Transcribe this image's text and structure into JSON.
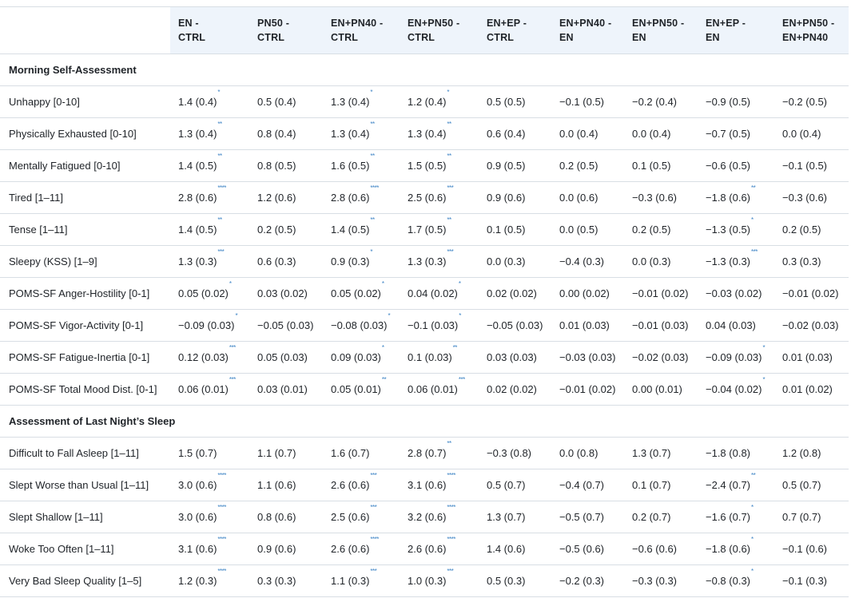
{
  "table": {
    "headers": [
      "",
      "EN - CTRL",
      "PN50 - CTRL",
      "EN+PN40 - CTRL",
      "EN+PN50 - CTRL",
      "EN+EP - CTRL",
      "EN+PN40 - EN",
      "EN+PN50 - EN",
      "EN+EP - EN",
      "EN+PN50 - EN+PN40"
    ],
    "header_lines": [
      [
        "",
        ""
      ],
      [
        "EN -",
        "CTRL"
      ],
      [
        "PN50 -",
        "CTRL"
      ],
      [
        "EN+PN40 -",
        "CTRL"
      ],
      [
        "EN+PN50 -",
        "CTRL"
      ],
      [
        "EN+EP -",
        "CTRL"
      ],
      [
        "EN+PN40 -",
        "EN"
      ],
      [
        "EN+PN50 -",
        "EN"
      ],
      [
        "EN+EP -",
        "EN"
      ],
      [
        "EN+PN50 -",
        "EN+PN40"
      ]
    ],
    "sections": [
      {
        "title": "Morning Self-Assessment",
        "rows": [
          {
            "label": "Unhappy [0-10]",
            "cells": [
              [
                "1.4 (0.4)",
                "*"
              ],
              [
                "0.5 (0.4)",
                ""
              ],
              [
                "1.3 (0.4)",
                "*"
              ],
              [
                "1.2 (0.4)",
                "*"
              ],
              [
                "0.5 (0.5)",
                ""
              ],
              [
                "−0.1 (0.5)",
                ""
              ],
              [
                "−0.2 (0.4)",
                ""
              ],
              [
                "−0.9 (0.5)",
                ""
              ],
              [
                "−0.2 (0.5)",
                ""
              ]
            ]
          },
          {
            "label": "Physically Exhausted [0-10]",
            "cells": [
              [
                "1.3 (0.4)",
                "**"
              ],
              [
                "0.8 (0.4)",
                ""
              ],
              [
                "1.3 (0.4)",
                "**"
              ],
              [
                "1.3 (0.4)",
                "**"
              ],
              [
                "0.6 (0.4)",
                ""
              ],
              [
                "0.0 (0.4)",
                ""
              ],
              [
                "0.0 (0.4)",
                ""
              ],
              [
                "−0.7 (0.5)",
                ""
              ],
              [
                "0.0 (0.4)",
                ""
              ]
            ]
          },
          {
            "label": "Mentally Fatigued [0-10]",
            "cells": [
              [
                "1.4 (0.5)",
                "**"
              ],
              [
                "0.8 (0.5)",
                ""
              ],
              [
                "1.6 (0.5)",
                "**"
              ],
              [
                "1.5 (0.5)",
                "**"
              ],
              [
                "0.9 (0.5)",
                ""
              ],
              [
                "0.2 (0.5)",
                ""
              ],
              [
                "0.1 (0.5)",
                ""
              ],
              [
                "−0.6 (0.5)",
                ""
              ],
              [
                "−0.1 (0.5)",
                ""
              ]
            ]
          },
          {
            "label": "Tired [1–11]",
            "cells": [
              [
                "2.8 (0.6)",
                "****"
              ],
              [
                "1.2 (0.6)",
                ""
              ],
              [
                "2.8 (0.6)",
                "****"
              ],
              [
                "2.5 (0.6)",
                "***"
              ],
              [
                "0.9 (0.6)",
                ""
              ],
              [
                "0.0 (0.6)",
                ""
              ],
              [
                "−0.3 (0.6)",
                ""
              ],
              [
                "−1.8 (0.6)",
                "**"
              ],
              [
                "−0.3 (0.6)",
                ""
              ]
            ]
          },
          {
            "label": "Tense [1–11]",
            "cells": [
              [
                "1.4 (0.5)",
                "**"
              ],
              [
                "0.2 (0.5)",
                ""
              ],
              [
                "1.4 (0.5)",
                "**"
              ],
              [
                "1.7 (0.5)",
                "**"
              ],
              [
                "0.1 (0.5)",
                ""
              ],
              [
                "0.0 (0.5)",
                ""
              ],
              [
                "0.2 (0.5)",
                ""
              ],
              [
                "−1.3 (0.5)",
                "*"
              ],
              [
                "0.2 (0.5)",
                ""
              ]
            ]
          },
          {
            "label": "Sleepy (KSS) [1–9]",
            "cells": [
              [
                "1.3 (0.3)",
                "***"
              ],
              [
                "0.6 (0.3)",
                ""
              ],
              [
                "0.9 (0.3)",
                "*"
              ],
              [
                "1.3 (0.3)",
                "***"
              ],
              [
                "0.0 (0.3)",
                ""
              ],
              [
                "−0.4 (0.3)",
                ""
              ],
              [
                "0.0 (0.3)",
                ""
              ],
              [
                "−1.3 (0.3)",
                "***"
              ],
              [
                "0.3 (0.3)",
                ""
              ]
            ]
          },
          {
            "label": "POMS-SF Anger-Hostility [0-1]",
            "cells": [
              [
                "0.05 (0.02)",
                "*"
              ],
              [
                "0.03 (0.02)",
                ""
              ],
              [
                "0.05 (0.02)",
                "*"
              ],
              [
                "0.04 (0.02)",
                "*"
              ],
              [
                "0.02 (0.02)",
                ""
              ],
              [
                "0.00 (0.02)",
                ""
              ],
              [
                "−0.01 (0.02)",
                ""
              ],
              [
                "−0.03 (0.02)",
                ""
              ],
              [
                "−0.01 (0.02)",
                ""
              ]
            ]
          },
          {
            "label": "POMS-SF Vigor-Activity [0-1]",
            "cells": [
              [
                "−0.09 (0.03)",
                "*"
              ],
              [
                "−0.05 (0.03)",
                ""
              ],
              [
                "−0.08 (0.03)",
                "*"
              ],
              [
                "−0.1 (0.03)",
                "*"
              ],
              [
                "−0.05 (0.03)",
                ""
              ],
              [
                "0.01 (0.03)",
                ""
              ],
              [
                "−0.01 (0.03)",
                ""
              ],
              [
                "0.04 (0.03)",
                ""
              ],
              [
                "−0.02 (0.03)",
                ""
              ]
            ]
          },
          {
            "label": "POMS-SF Fatigue-Inertia [0-1]",
            "cells": [
              [
                "0.12 (0.03)",
                "***"
              ],
              [
                "0.05 (0.03)",
                ""
              ],
              [
                "0.09 (0.03)",
                "*"
              ],
              [
                "0.1 (0.03)",
                "**"
              ],
              [
                "0.03 (0.03)",
                ""
              ],
              [
                "−0.03 (0.03)",
                ""
              ],
              [
                "−0.02 (0.03)",
                ""
              ],
              [
                "−0.09 (0.03)",
                "*"
              ],
              [
                "0.01 (0.03)",
                ""
              ]
            ]
          },
          {
            "label": "POMS-SF Total Mood Dist. [0-1]",
            "cells": [
              [
                "0.06 (0.01)",
                "***"
              ],
              [
                "0.03 (0.01)",
                ""
              ],
              [
                "0.05 (0.01)",
                "**"
              ],
              [
                "0.06 (0.01)",
                "***"
              ],
              [
                "0.02 (0.02)",
                ""
              ],
              [
                "−0.01 (0.02)",
                ""
              ],
              [
                "0.00 (0.01)",
                ""
              ],
              [
                "−0.04 (0.02)",
                "*"
              ],
              [
                "0.01 (0.02)",
                ""
              ]
            ]
          }
        ]
      },
      {
        "title": "Assessment of Last Night’s Sleep",
        "rows": [
          {
            "label": "Difficult to Fall Asleep [1–11]",
            "cells": [
              [
                "1.5 (0.7)",
                ""
              ],
              [
                "1.1 (0.7)",
                ""
              ],
              [
                "1.6 (0.7)",
                ""
              ],
              [
                "2.8 (0.7)",
                "**"
              ],
              [
                "−0.3 (0.8)",
                ""
              ],
              [
                "0.0 (0.8)",
                ""
              ],
              [
                "1.3 (0.7)",
                ""
              ],
              [
                "−1.8 (0.8)",
                ""
              ],
              [
                "1.2 (0.8)",
                ""
              ]
            ]
          },
          {
            "label": "Slept Worse than Usual [1–11]",
            "cells": [
              [
                "3.0 (0.6)",
                "****"
              ],
              [
                "1.1 (0.6)",
                ""
              ],
              [
                "2.6 (0.6)",
                "***"
              ],
              [
                "3.1 (0.6)",
                "****"
              ],
              [
                "0.5 (0.7)",
                ""
              ],
              [
                "−0.4 (0.7)",
                ""
              ],
              [
                "0.1 (0.7)",
                ""
              ],
              [
                "−2.4 (0.7)",
                "**"
              ],
              [
                "0.5 (0.7)",
                ""
              ]
            ]
          },
          {
            "label": "Slept Shallow [1–11]",
            "cells": [
              [
                "3.0 (0.6)",
                "****"
              ],
              [
                "0.8 (0.6)",
                ""
              ],
              [
                "2.5 (0.6)",
                "***"
              ],
              [
                "3.2 (0.6)",
                "****"
              ],
              [
                "1.3 (0.7)",
                ""
              ],
              [
                "−0.5 (0.7)",
                ""
              ],
              [
                "0.2 (0.7)",
                ""
              ],
              [
                "−1.6 (0.7)",
                "*"
              ],
              [
                "0.7 (0.7)",
                ""
              ]
            ]
          },
          {
            "label": "Woke Too Often [1–11]",
            "cells": [
              [
                "3.1 (0.6)",
                "****"
              ],
              [
                "0.9 (0.6)",
                ""
              ],
              [
                "2.6 (0.6)",
                "****"
              ],
              [
                "2.6 (0.6)",
                "****"
              ],
              [
                "1.4 (0.6)",
                ""
              ],
              [
                "−0.5 (0.6)",
                ""
              ],
              [
                "−0.6 (0.6)",
                ""
              ],
              [
                "−1.8 (0.6)",
                "*"
              ],
              [
                "−0.1 (0.6)",
                ""
              ]
            ]
          },
          {
            "label": "Very Bad Sleep Quality [1–5]",
            "cells": [
              [
                "1.2 (0.3)",
                "****"
              ],
              [
                "0.3 (0.3)",
                ""
              ],
              [
                "1.1 (0.3)",
                "***"
              ],
              [
                "1.0 (0.3)",
                "***"
              ],
              [
                "0.5 (0.3)",
                ""
              ],
              [
                "−0.2 (0.3)",
                ""
              ],
              [
                "−0.3 (0.3)",
                ""
              ],
              [
                "−0.8 (0.3)",
                "*"
              ],
              [
                "−0.1 (0.3)",
                ""
              ]
            ]
          }
        ]
      }
    ]
  }
}
